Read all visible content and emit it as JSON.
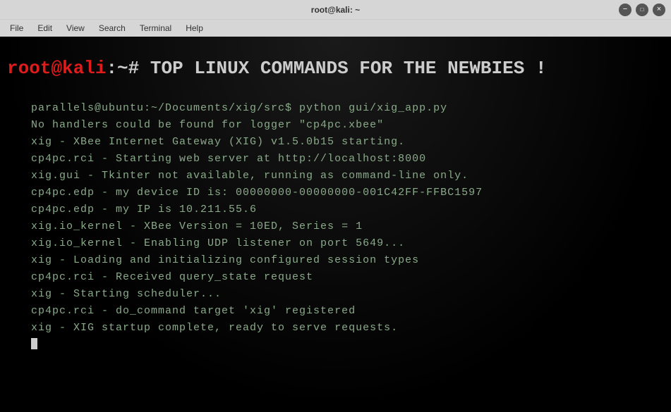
{
  "window": {
    "title": "root@kali: ~"
  },
  "menu": {
    "items": [
      "File",
      "Edit",
      "View",
      "Search",
      "Terminal",
      "Help"
    ]
  },
  "prompt": {
    "user_host": "root@kali",
    "separator": ":~# ",
    "command": "TOP LINUX COMMANDS FOR THE NEWBIES !"
  },
  "output": {
    "lines": [
      "parallels@ubuntu:~/Documents/xig/src$ python gui/xig_app.py",
      "No handlers could be found for logger \"cp4pc.xbee\"",
      "xig - XBee Internet Gateway (XIG) v1.5.0b15 starting.",
      "cp4pc.rci - Starting web server at http://localhost:8000",
      "xig.gui - Tkinter not available, running as command-line only.",
      "cp4pc.edp - my device ID is: 00000000-00000000-001C42FF-FFBC1597",
      "cp4pc.edp - my IP is 10.211.55.6",
      "xig.io_kernel - XBee Version = 10ED, Series = 1",
      "xig.io_kernel - Enabling UDP listener on port 5649...",
      "xig - Loading and initializing configured session types",
      "cp4pc.rci - Received query_state request",
      "xig - Starting scheduler...",
      "cp4pc.rci - do_command target 'xig' registered",
      "xig - XIG startup complete, ready to serve requests."
    ]
  }
}
